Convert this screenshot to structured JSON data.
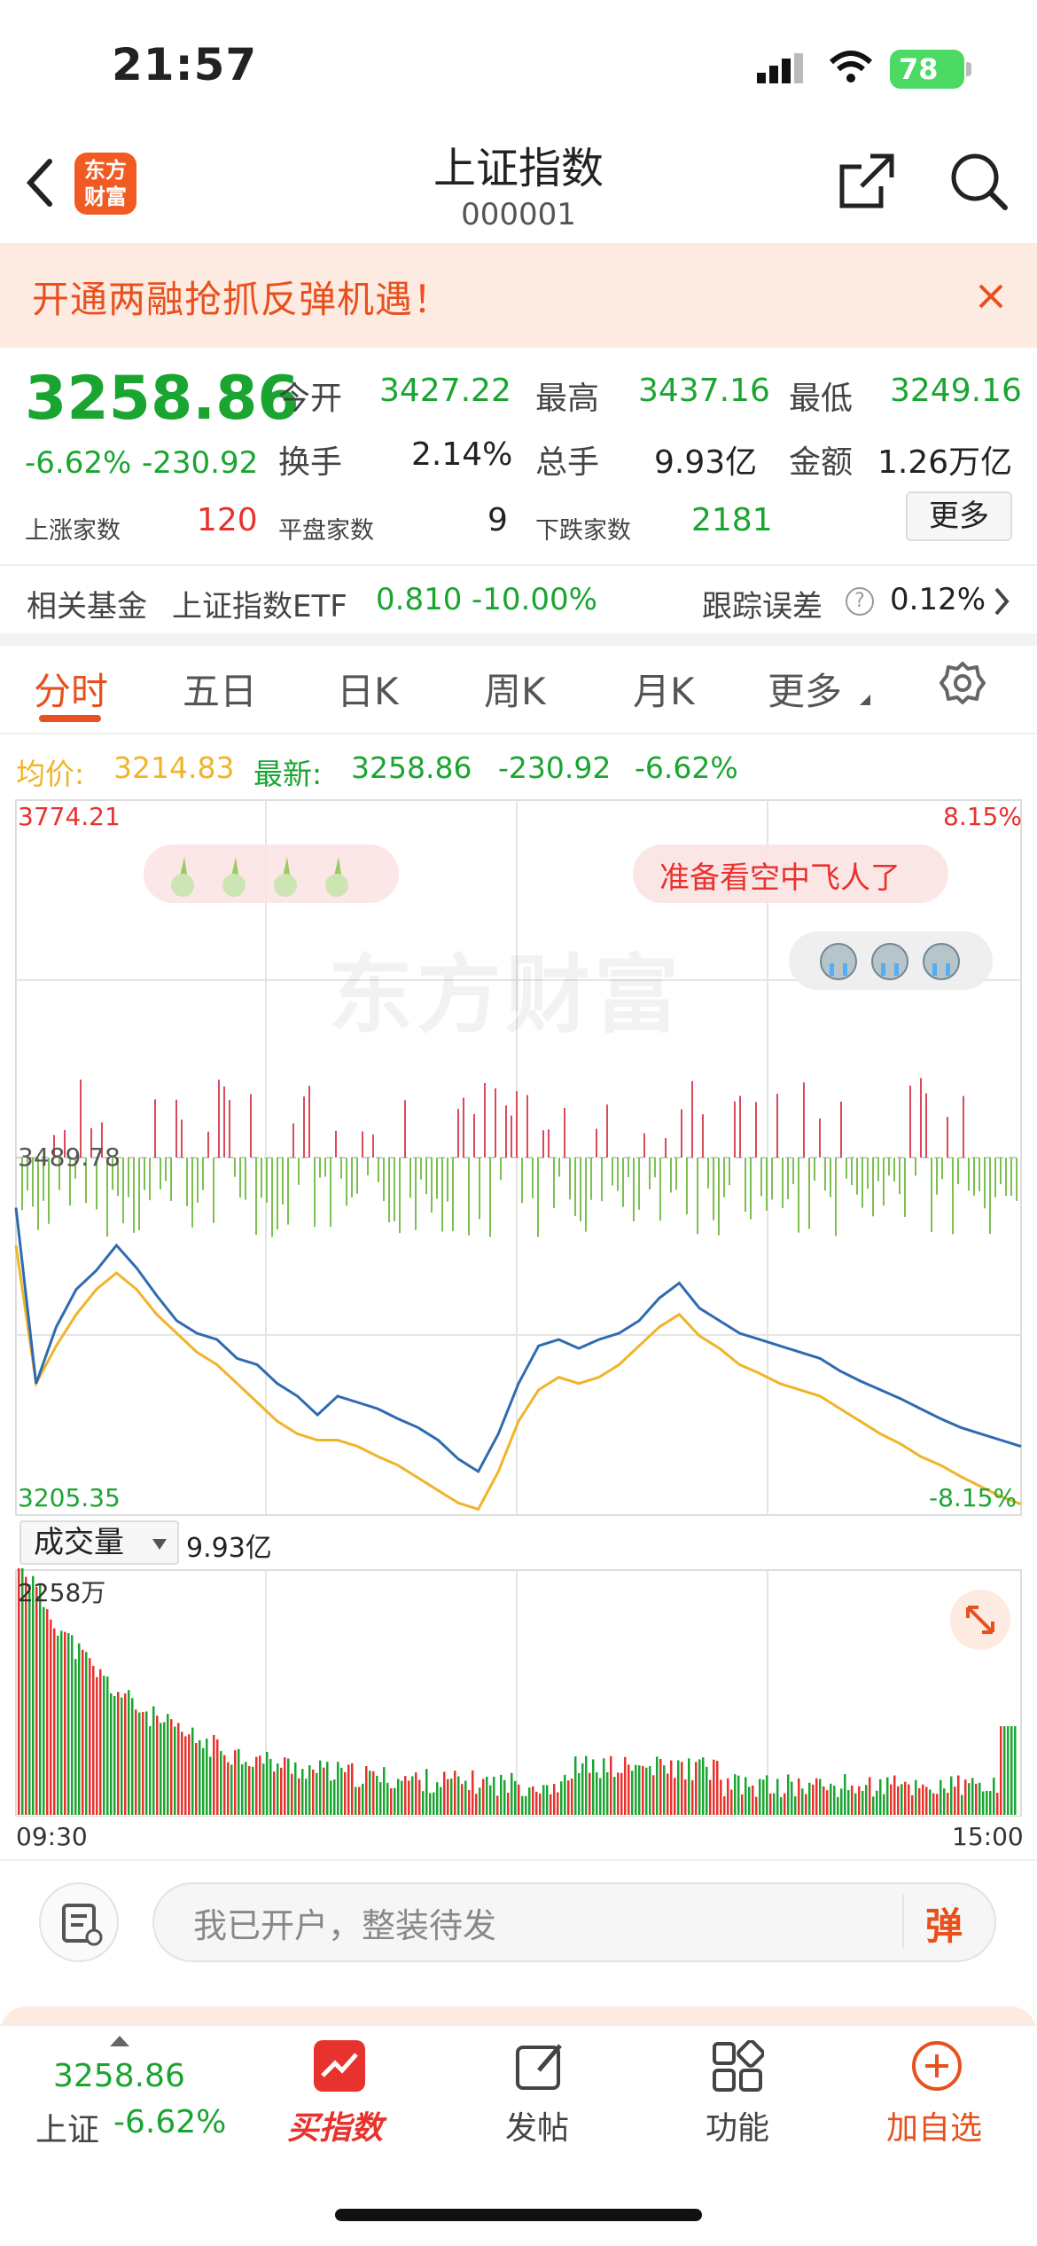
{
  "status_bar": {
    "time": "21:57",
    "battery": "78"
  },
  "header": {
    "title": "上证指数",
    "code": "000001",
    "logo_text": "东方财富"
  },
  "banner": {
    "text": "开通两融抢抓反弹机遇！"
  },
  "quote": {
    "price": "3258.86",
    "change_pct": "-6.62%",
    "change": "-230.92",
    "open_label": "今开",
    "open": "3427.22",
    "high_label": "最高",
    "high": "3437.16",
    "low_label": "最低",
    "low": "3249.16",
    "turnover_label": "换手",
    "turnover": "2.14%",
    "volume_label": "总手",
    "volume": "9.93亿",
    "amount_label": "金额",
    "amount": "1.26万亿",
    "up_label": "上涨家数",
    "up": "120",
    "flat_label": "平盘家数",
    "flat": "9",
    "down_label": "下跌家数",
    "down": "2181",
    "more_label": "更多"
  },
  "fund": {
    "label": "相关基金",
    "name": "上证指数ETF",
    "price": "0.810",
    "change": "-10.00%",
    "track_label": "跟踪误差",
    "track_value": "0.12%"
  },
  "tabs": [
    "分时",
    "五日",
    "日K",
    "周K",
    "月K",
    "更多"
  ],
  "info_line": {
    "avg_label": "均价:",
    "avg": "3214.83",
    "latest_label": "最新:",
    "latest": "3258.86",
    "change": "-230.92",
    "pct": "-6.62%"
  },
  "chart_labels": {
    "y_top": "3774.21",
    "y_mid": "3489.78",
    "y_bottom": "3205.35",
    "pct_top": "8.15%",
    "pct_bottom": "-8.15%",
    "bubble_text": "准备看空中飞人了",
    "watermark": "东方财富"
  },
  "volume": {
    "selector": "成交量",
    "total": "9.93亿",
    "max": "2258万",
    "t_start": "09:30",
    "t_end": "15:00"
  },
  "comment": {
    "placeholder": "我已开户，整装待发",
    "danmu": "弹"
  },
  "bottom_nav": {
    "price": "3258.86",
    "name": "上证",
    "pct": "-6.62%",
    "items": [
      "买指数",
      "发帖",
      "功能",
      "加自选"
    ]
  },
  "colors": {
    "up": "#e8322d",
    "down": "#1aa531",
    "accent": "#e8501d",
    "price_line": "#2e6bb0",
    "avg_line": "#f0b429"
  },
  "chart_data": [
    {
      "type": "line",
      "title": "",
      "ylim": [
        3205.35,
        3774.21
      ],
      "x": [
        "09:30",
        "15:00"
      ],
      "series": [
        {
          "name": "最新",
          "values": [
            3450,
            3310,
            3355,
            3385,
            3400,
            3420,
            3402,
            3380,
            3360,
            3350,
            3345,
            3330,
            3325,
            3310,
            3300,
            3285,
            3300,
            3295,
            3290,
            3282,
            3275,
            3265,
            3250,
            3240,
            3270,
            3310,
            3340,
            3345,
            3338,
            3345,
            3350,
            3360,
            3378,
            3390,
            3370,
            3360,
            3350,
            3345,
            3340,
            3335,
            3330,
            3320,
            3312,
            3305,
            3298,
            3290,
            3282,
            3275,
            3270,
            3265,
            3260
          ]
        },
        {
          "name": "均价",
          "values": [
            3420,
            3310,
            3340,
            3365,
            3385,
            3398,
            3385,
            3365,
            3350,
            3335,
            3325,
            3310,
            3295,
            3280,
            3270,
            3265,
            3265,
            3260,
            3252,
            3245,
            3235,
            3225,
            3215,
            3210,
            3240,
            3280,
            3305,
            3315,
            3310,
            3315,
            3325,
            3340,
            3355,
            3365,
            3348,
            3338,
            3325,
            3318,
            3310,
            3305,
            3300,
            3290,
            3280,
            3270,
            3262,
            3252,
            3245,
            3236,
            3228,
            3220,
            3214
          ]
        }
      ]
    }
  ]
}
